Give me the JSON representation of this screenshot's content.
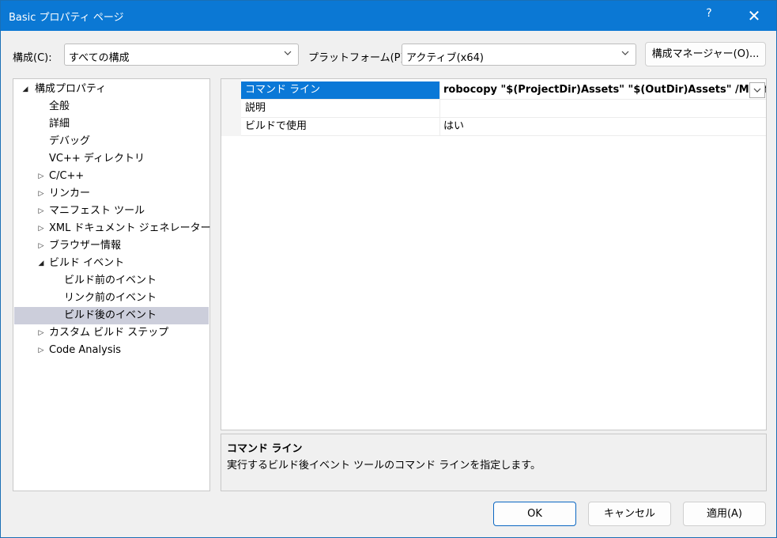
{
  "window": {
    "title": "Basic プロパティ ページ",
    "help_glyph": "?",
    "close_glyph": "✕"
  },
  "toolbar": {
    "config_label": "構成(C):",
    "config_value": "すべての構成",
    "platform_label": "プラットフォーム(P):",
    "platform_value": "アクティブ(x64)",
    "config_manager_label": "構成マネージャー(O)..."
  },
  "tree": {
    "items": [
      {
        "label": "構成プロパティ",
        "arrow": "◢",
        "level": 0,
        "selected": false
      },
      {
        "label": "全般",
        "arrow": "",
        "level": 1,
        "selected": false
      },
      {
        "label": "詳細",
        "arrow": "",
        "level": 1,
        "selected": false
      },
      {
        "label": "デバッグ",
        "arrow": "",
        "level": 1,
        "selected": false
      },
      {
        "label": "VC++ ディレクトリ",
        "arrow": "",
        "level": 1,
        "selected": false
      },
      {
        "label": "C/C++",
        "arrow": "▷",
        "level": 1,
        "selected": false
      },
      {
        "label": "リンカー",
        "arrow": "▷",
        "level": 1,
        "selected": false
      },
      {
        "label": "マニフェスト ツール",
        "arrow": "▷",
        "level": 1,
        "selected": false
      },
      {
        "label": "XML ドキュメント ジェネレーター",
        "arrow": "▷",
        "level": 1,
        "selected": false
      },
      {
        "label": "ブラウザー情報",
        "arrow": "▷",
        "level": 1,
        "selected": false
      },
      {
        "label": "ビルド イベント",
        "arrow": "◢",
        "level": 1,
        "selected": false
      },
      {
        "label": "ビルド前のイベント",
        "arrow": "",
        "level": 2,
        "selected": false
      },
      {
        "label": "リンク前のイベント",
        "arrow": "",
        "level": 2,
        "selected": false
      },
      {
        "label": "ビルド後のイベント",
        "arrow": "",
        "level": 2,
        "selected": true
      },
      {
        "label": "カスタム ビルド ステップ",
        "arrow": "▷",
        "level": 1,
        "selected": false
      },
      {
        "label": "Code Analysis",
        "arrow": "▷",
        "level": 1,
        "selected": false
      }
    ]
  },
  "grid": {
    "rows": [
      {
        "name": "コマンド ライン",
        "value": "robocopy \"$(ProjectDir)Assets\" \"$(OutDir)Assets\" /MIRif $",
        "selected": true
      },
      {
        "name": "説明",
        "value": "",
        "selected": false
      },
      {
        "name": "ビルドで使用",
        "value": "はい",
        "selected": false
      }
    ]
  },
  "description": {
    "title": "コマンド ライン",
    "text": "実行するビルド後イベント ツールのコマンド ラインを指定します。"
  },
  "footer": {
    "ok_label": "OK",
    "cancel_label": "キャンセル",
    "apply_label": "適用(A)"
  },
  "colors": {
    "title_bar": "#0b78d4",
    "selected_row": "#0a78d7",
    "selected_tree": "#cccedb"
  }
}
